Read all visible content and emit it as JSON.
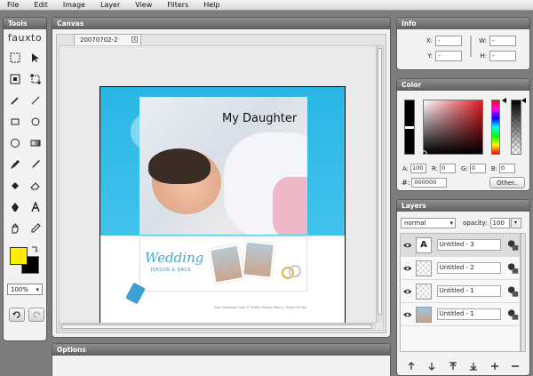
{
  "menu": [
    "File",
    "Edit",
    "Image",
    "Layer",
    "View",
    "Filters",
    "Help"
  ],
  "tools_panel": {
    "title": "Tools",
    "logo": "fauxto",
    "zoom": "100%"
  },
  "canvas_panel": {
    "title": "Canvas",
    "doc_tab": "20070702-2",
    "photo_title": "My Daughter",
    "wedding_title": "Wedding",
    "wedding_names": "JERSON & DACK",
    "footer_text": "Fran Compson Certs © 2006 | Privacy Policy | Terms Of Use"
  },
  "options_panel": {
    "title": "Options"
  },
  "info_panel": {
    "title": "Info",
    "x_label": "X:",
    "x_value": "-",
    "y_label": "Y:",
    "y_value": "-",
    "w_label": "W:",
    "w_value": "-",
    "h_label": "H:",
    "h_value": "-"
  },
  "color_panel": {
    "title": "Color",
    "a_label": "A:",
    "a_value": "100",
    "r_label": "R:",
    "r_value": "0",
    "g_label": "G:",
    "g_value": "0",
    "b_label": "B:",
    "b_value": "0",
    "hex_label": "#:",
    "hex_value": "000000",
    "other_button": "Other..",
    "foreground": "#ffee00",
    "background": "#000000"
  },
  "layers_panel": {
    "title": "Layers",
    "blend_mode": "normal",
    "opacity_label": "opacity:",
    "opacity_value": "100",
    "layers": [
      {
        "name": "Untitled - 3",
        "thumb": "A"
      },
      {
        "name": "Untitled - 2",
        "thumb": ""
      },
      {
        "name": "Untitled - 1",
        "thumb": ""
      },
      {
        "name": "Untitled - 1",
        "thumb": ""
      }
    ]
  }
}
